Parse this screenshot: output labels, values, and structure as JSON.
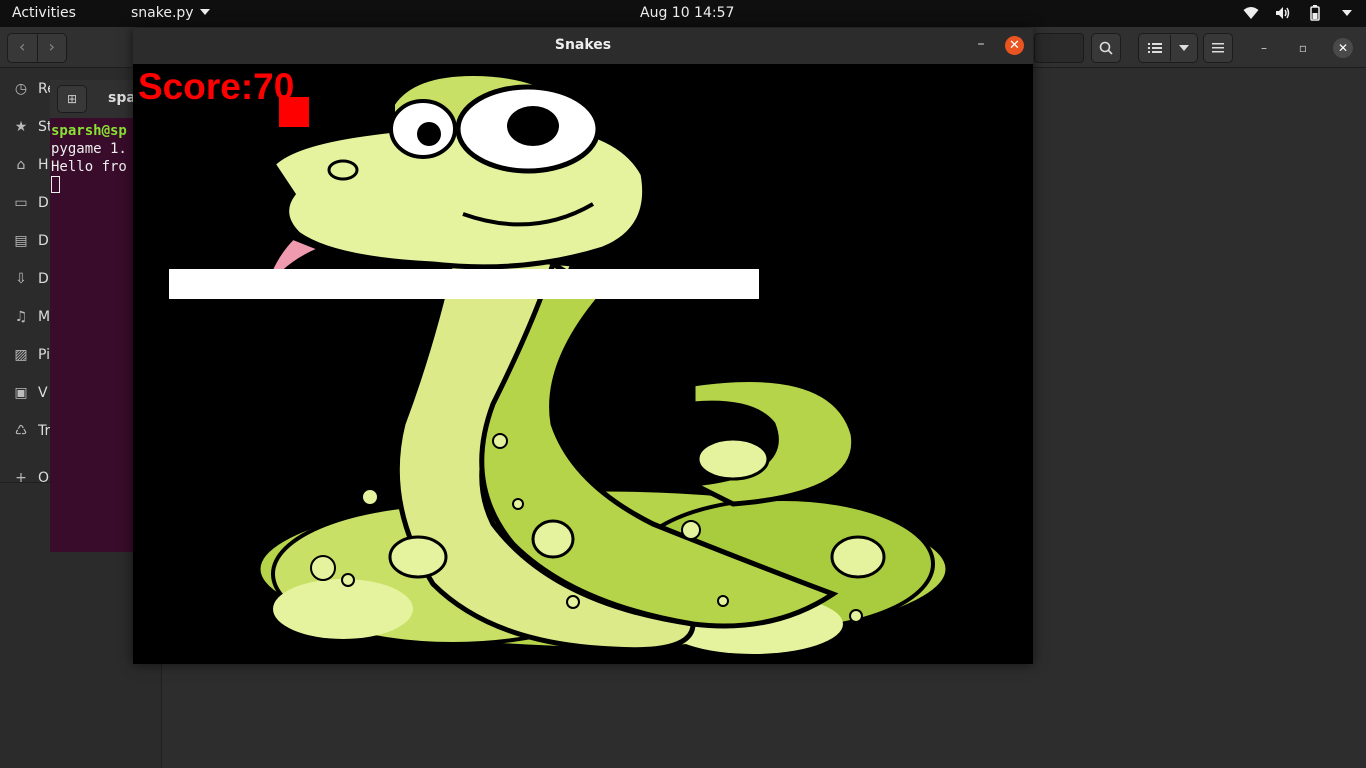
{
  "topbar": {
    "activities": "Activities",
    "app_name": "snake.py",
    "clock": "Aug 10  14:57"
  },
  "files_sidebar": {
    "items": [
      {
        "label": "Re",
        "icon": "clock-icon"
      },
      {
        "label": "St",
        "icon": "star-icon"
      },
      {
        "label": "H",
        "icon": "home-icon"
      },
      {
        "label": "D",
        "icon": "desktop-icon"
      },
      {
        "label": "D",
        "icon": "document-icon"
      },
      {
        "label": "D",
        "icon": "download-icon"
      },
      {
        "label": "M",
        "icon": "music-icon"
      },
      {
        "label": "Pi",
        "icon": "picture-icon"
      },
      {
        "label": "V",
        "icon": "video-icon"
      },
      {
        "label": "Tr",
        "icon": "trash-icon"
      },
      {
        "label": "O",
        "icon": "plus-icon"
      }
    ]
  },
  "terminal": {
    "title": "spa",
    "prompt": "sparsh@sp",
    "line1": "pygame 1.",
    "line2": "Hello fro"
  },
  "game_window": {
    "title": "Snakes",
    "score_text": "Score:70",
    "colors": {
      "background": "#000000",
      "score": "#ff0000",
      "food": "#ff0000",
      "snake": "#ffffff"
    }
  }
}
